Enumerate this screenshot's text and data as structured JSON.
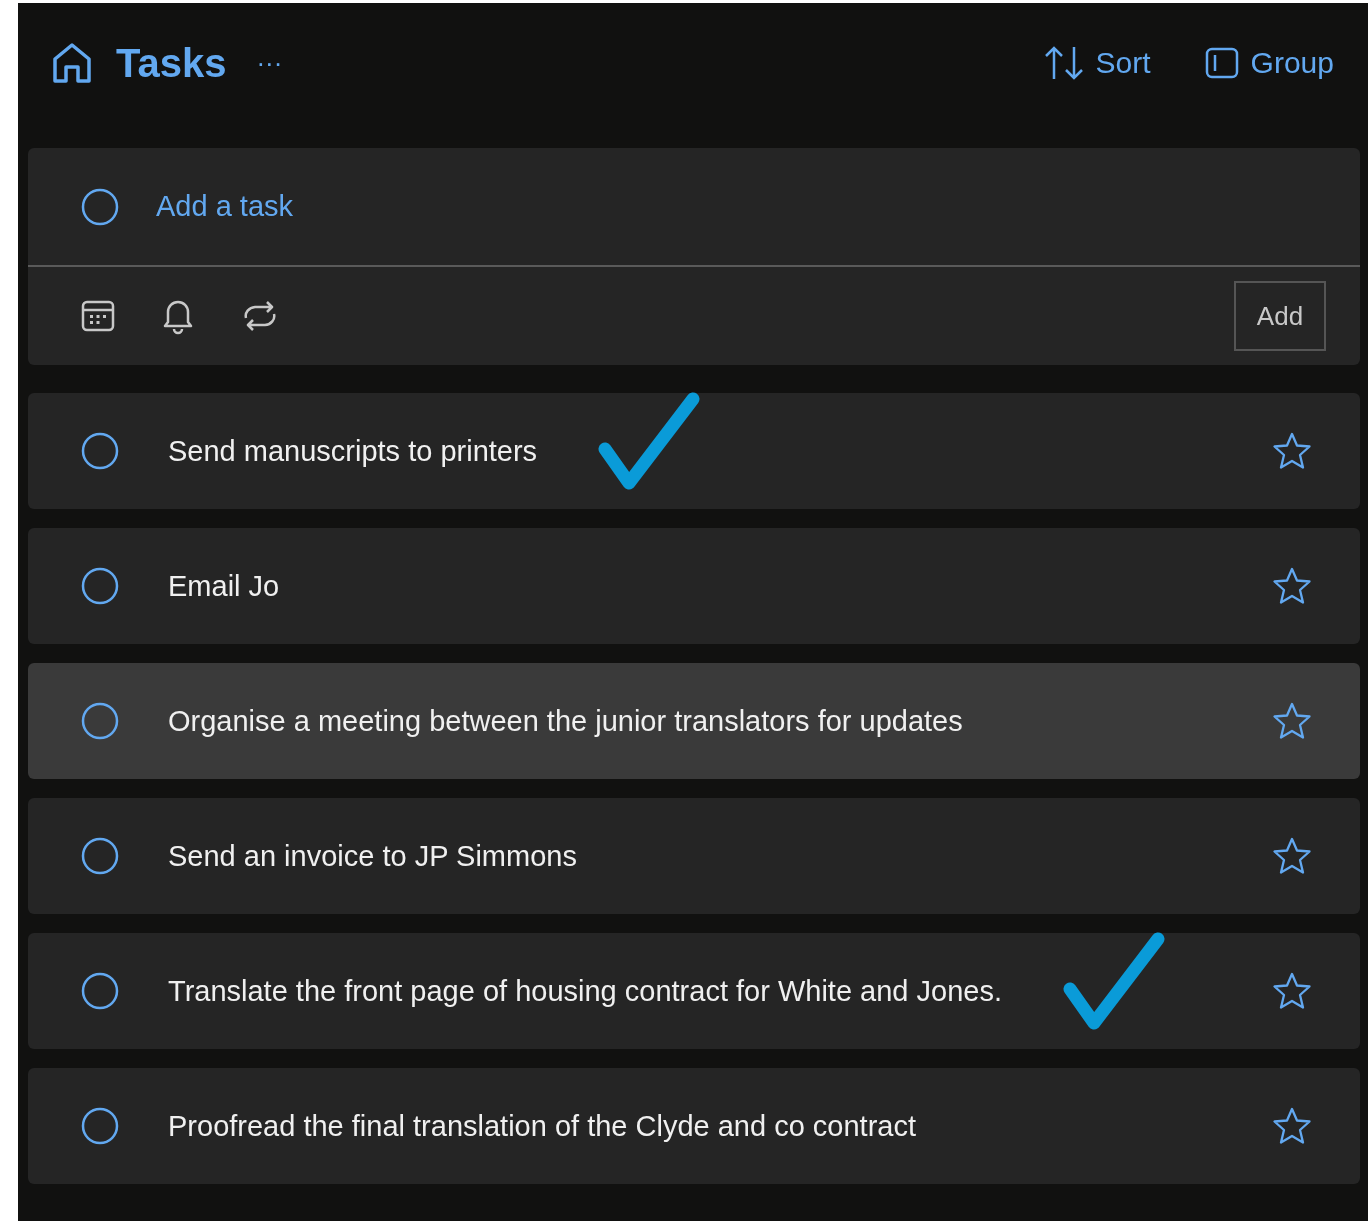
{
  "header": {
    "title": "Tasks",
    "more": "···",
    "actions": [
      {
        "kind": "sort",
        "label": "Sort"
      },
      {
        "kind": "group",
        "label": "Group"
      }
    ]
  },
  "add_task": {
    "placeholder": "Add a task",
    "button": "Add"
  },
  "tasks": [
    {
      "title": "Send manuscripts to printers",
      "completed": false,
      "starred": false,
      "highlighted": false,
      "annotated": true
    },
    {
      "title": "Email Jo",
      "completed": false,
      "starred": false,
      "highlighted": false,
      "annotated": false
    },
    {
      "title": "Organise a meeting between the junior translators for updates",
      "completed": false,
      "starred": false,
      "highlighted": true,
      "annotated": false
    },
    {
      "title": "Send an invoice to JP Simmons",
      "completed": false,
      "starred": false,
      "highlighted": false,
      "annotated": false
    },
    {
      "title": "Translate the front page of housing contract for White and Jones.",
      "completed": false,
      "starred": false,
      "highlighted": false,
      "annotated": true
    },
    {
      "title": "Proofread the final translation of the Clyde and co contract",
      "completed": false,
      "starred": false,
      "highlighted": false,
      "annotated": false
    }
  ]
}
